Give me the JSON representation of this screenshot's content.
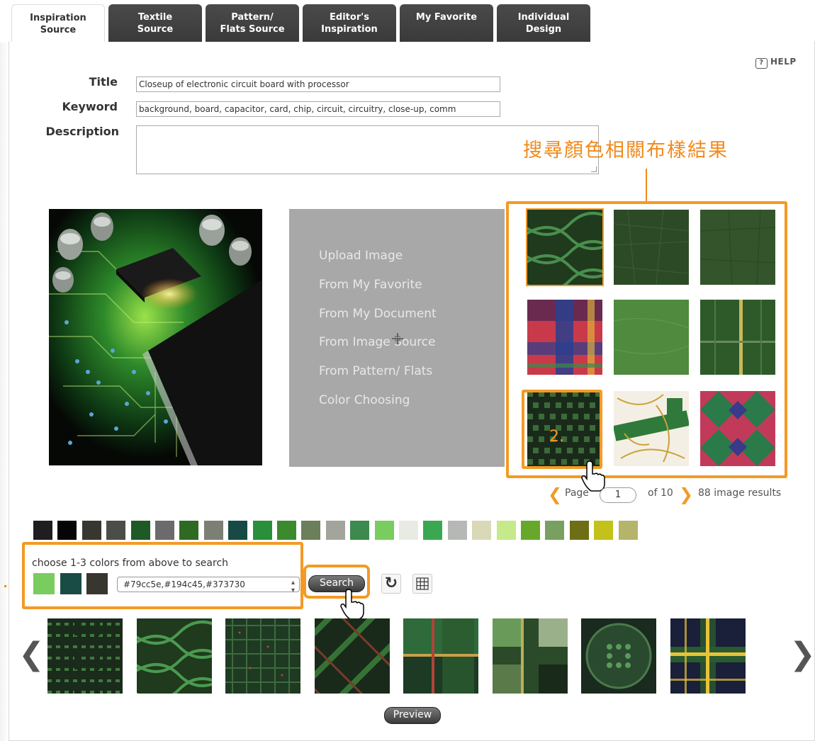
{
  "tabs": [
    {
      "label": "Inspiration\nSource",
      "active": true
    },
    {
      "label": "Textile\nSource",
      "active": false
    },
    {
      "label": "Pattern/\nFlats Source",
      "active": false
    },
    {
      "label": "Editor's\nInspiration",
      "active": false
    },
    {
      "label": "My Favorite",
      "active": false
    },
    {
      "label": "Individual\nDesign",
      "active": false
    }
  ],
  "help": {
    "icon": "question-icon",
    "label": "HELP"
  },
  "form": {
    "title_label": "Title",
    "title_value": "Closeup of electronic circuit board with processor",
    "keyword_label": "Keyword",
    "keyword_value": "background, board, capacitor, card, chip, circuit, circuitry, close-up, comm",
    "description_label": "Description",
    "description_value": ""
  },
  "callout": {
    "text": "搜尋顏色相關布樣結果",
    "color": "#f08a1c"
  },
  "source_menu": [
    "Upload Image",
    "From My Favorite",
    "From My Document",
    "From Image Source",
    "From Pattern/ Flats",
    "Color Choosing"
  ],
  "results": {
    "thumbnails": [
      "green-lattice-fabric",
      "green-textured-fabric",
      "green-canvas-fabric",
      "red-blue-plaid-fabric",
      "green-linen-fabric",
      "green-stripe-plaid-fabric",
      "green-houndstooth-fabric",
      "chain-print-fabric",
      "argyle-diamond-fabric"
    ],
    "step_marker": "2.",
    "pager_label": "Page",
    "page_value": "1",
    "of_label": "of 10",
    "result_count": "88 image results"
  },
  "palette": [
    "#1e1e1e",
    "#050505",
    "#373730",
    "#4a4d48",
    "#1d5a26",
    "#6b6b6e",
    "#2f6a22",
    "#7c7f74",
    "#184a45",
    "#2a8f3a",
    "#3b8a2e",
    "#6a7f5a",
    "#a3a59c",
    "#3c8a4e",
    "#79cc5e",
    "#e8eae4",
    "#3aa850",
    "#b5b8b5",
    "#d9d9b8",
    "#c6e98a",
    "#67a82a",
    "#78a060",
    "#6e6e14",
    "#c2c21a",
    "#b4b46a"
  ],
  "color_search": {
    "instruction": "choose 1-3 colors from above to search",
    "selected_colors": [
      "#79cc5e",
      "#194c45",
      "#373730"
    ],
    "select_value": "#79cc5e,#194c45,#373730",
    "search_label": "Search",
    "refresh_icon": "refresh-icon",
    "grid_icon": "grid-icon"
  },
  "related": {
    "thumbnails": [
      "green-houndstooth",
      "green-lattice",
      "green-tweed",
      "green-diagonal-plaid",
      "green-tartan",
      "green-check",
      "green-circle-weave",
      "navy-yellow-tartan"
    ],
    "preview_label": "Preview"
  },
  "accent_color": "#f39a24"
}
